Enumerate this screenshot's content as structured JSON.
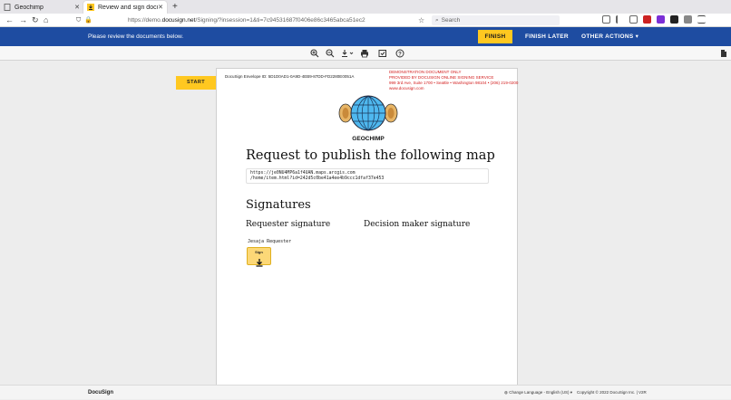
{
  "browser": {
    "tabs": [
      {
        "label": "Geochimp",
        "active": false
      },
      {
        "label": "Review and sign documen",
        "active": true
      }
    ],
    "url_prefix": "https://demo.",
    "url_domain": "docusign.net",
    "url_path": "/Signing/?insession=1&ti=7c94531687f0406e86c3465abca51ec2",
    "search_placeholder": "Search"
  },
  "header": {
    "message": "Please review the documents below.",
    "finish_label": "FINISH",
    "finish_later_label": "FINISH LATER",
    "other_actions_label": "OTHER ACTIONS",
    "accent_color": "#ffc820",
    "bar_color": "#1e4ca1"
  },
  "doc_toolbar": {
    "icons": [
      "zoom-in-icon",
      "zoom-out-icon",
      "download-icon",
      "print-icon",
      "view-attachments-icon",
      "help-icon",
      "file-icon"
    ]
  },
  "sidebar": {
    "start_label": "START"
  },
  "document": {
    "envelope_id": "DocuSign Envelope ID: 5D1D0AD1-0A9D-4EB9-87DD-FD2280E0051A",
    "demo_lines": [
      "DEMONSTRATION DOCUMENT ONLY",
      "PROVIDED BY DOCUSIGN ONLINE SIGNING SERVICE",
      "999 3rd Ave, Suite 1700  • Seattle • Washington 98104 • (206) 219-0200",
      "www.docusign.com"
    ],
    "logo_text": "GEOCHIMP",
    "title": "Request to publish the following map",
    "map_url_line1": "https://je0NU4MP6a1f4UAN.maps.arcgis.com",
    "map_url_line2": "/home/item.html?id=242d5c0be41a4ee4b9ccc1dfaf37e453",
    "signatures_heading": "Signatures",
    "requester_heading": "Requester signature",
    "decision_heading": "Decision maker signature",
    "requester_name": "Jesaja Requester",
    "sign_label": "Sign"
  },
  "footer": {
    "brand": "DocuSign",
    "language": "Change Language - English (US)",
    "copyright": "Copyright © 2022 DocuSign Inc.  |  V2R"
  }
}
